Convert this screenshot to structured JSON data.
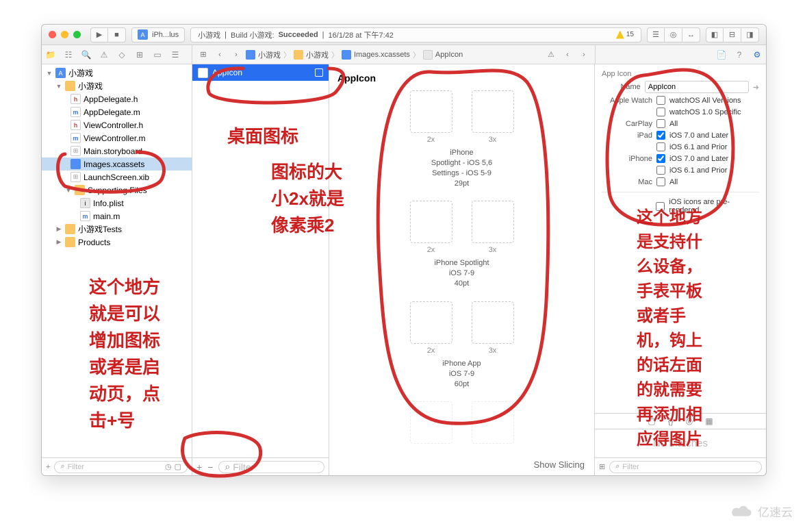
{
  "titlebar": {
    "scheme_target": "iPh...lus",
    "scheme_app": "小游戏",
    "build_prefix": "Build 小游戏: ",
    "build_status": "Succeeded",
    "timestamp": "16/1/28 at 下午7:42",
    "warn_count": "15"
  },
  "nav": {
    "root": "小游戏",
    "group": "小游戏",
    "files": {
      "appdelegate_h": "AppDelegate.h",
      "appdelegate_m": "AppDelegate.m",
      "viewcontroller_h": "ViewController.h",
      "viewcontroller_m": "ViewController.m",
      "mainstoryboard": "Main.storyboard",
      "imagesxcassets": "Images.xcassets",
      "launchscreen": "LaunchScreen.xib",
      "supporting": "Supporting Files",
      "infoplist": "Info.plist",
      "mainm": "main.m",
      "tests": "‎小游戏Tests",
      "products": "Products"
    },
    "filter_placeholder": "Filter",
    "plus": "+"
  },
  "crumb": {
    "seg1": "小游戏",
    "seg2": "小游戏",
    "seg3": "Images.xcassets",
    "seg4": "AppIcon"
  },
  "assetlist": {
    "item": "AppIcon",
    "filter_placeholder": "Filter",
    "plus": "+",
    "minus": "−"
  },
  "canvas": {
    "title": "AppIcon",
    "x2": "2x",
    "x3": "3x",
    "cap1_l1": "iPhone",
    "cap1_l2": "Spotlight - iOS 5,6",
    "cap1_l3": "Settings - iOS 5-9",
    "cap1_l4": "29pt",
    "cap2_l1": "iPhone Spotlight",
    "cap2_l2": "iOS 7-9",
    "cap2_l3": "40pt",
    "cap3_l1": "iPhone App",
    "cap3_l2": "iOS 7-9",
    "cap3_l3": "60pt",
    "show_slicing": "Show Slicing"
  },
  "inspector": {
    "section": "App Icon",
    "name_label": "Name",
    "name_value": "AppIcon",
    "apple_watch": "Apple Watch",
    "watchos_all": "watchOS All Versions",
    "watchos_10": "watchOS 1.0 Specific",
    "carplay": "CarPlay",
    "carplay_all": "All",
    "ipad": "iPad",
    "ios7later": "iOS 7.0 and Later",
    "ios61prior": "iOS 6.1 and Prior",
    "iphone": "iPhone",
    "mac": "Mac",
    "mac_all": "All",
    "prerendered": "iOS icons are pre-rendered",
    "no_matches": "No Matches",
    "filter_placeholder": "Filter"
  },
  "annotations": {
    "a1": "桌面图标",
    "a2_l1": "图标的大",
    "a2_l2": "小2x就是",
    "a2_l3": "像素乘2",
    "a3_l1": "这个地方",
    "a3_l2": "就是可以",
    "a3_l3": "增加图标",
    "a3_l4": "或者是启",
    "a3_l5": "动页，点",
    "a3_l6": "击+号",
    "a4_l1": "这个地方",
    "a4_l2": "是支持什",
    "a4_l3": "么设备，",
    "a4_l4": "手表平板",
    "a4_l5": "或者手",
    "a4_l6": "机，钩上",
    "a4_l7": "的话左面",
    "a4_l8": "的就需要",
    "a4_l9": "再添加相",
    "a4_l10": "应得图片"
  },
  "watermark": "亿速云"
}
